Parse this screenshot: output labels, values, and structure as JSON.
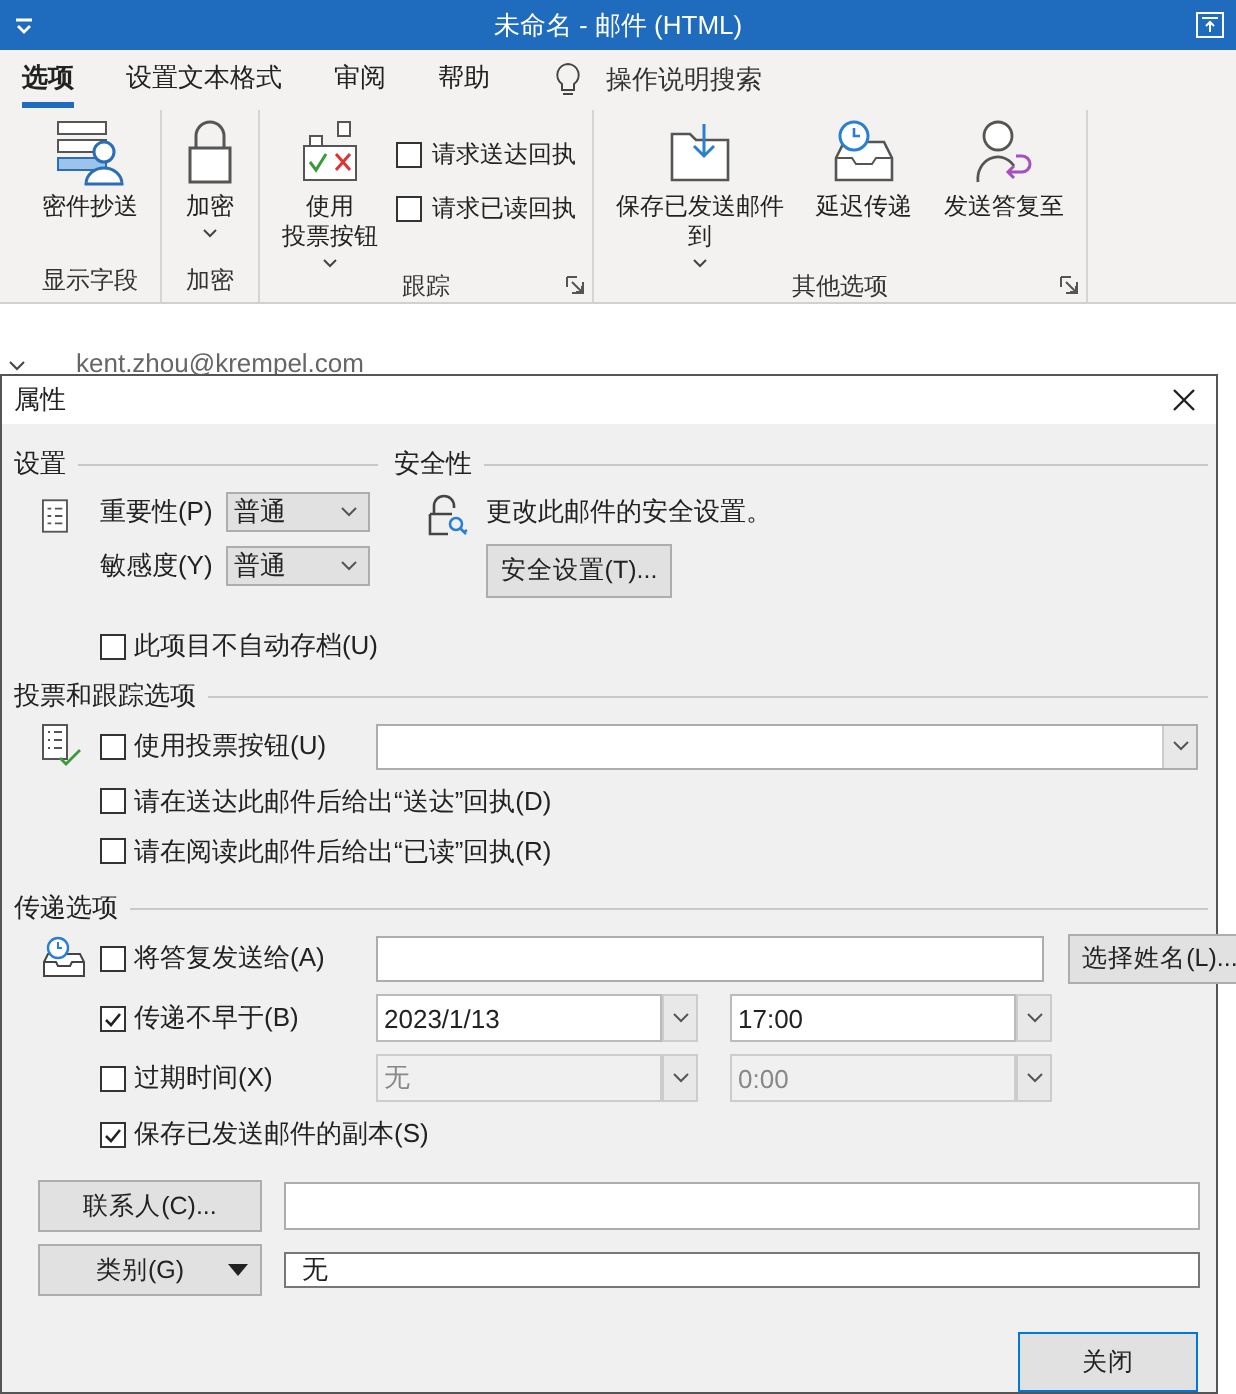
{
  "window": {
    "title": "未命名 - 邮件 (HTML)"
  },
  "ribbon": {
    "tabs": [
      {
        "label": "选项",
        "selected": true
      },
      {
        "label": "设置文本格式",
        "selected": false
      },
      {
        "label": "审阅",
        "selected": false
      },
      {
        "label": "帮助",
        "selected": false
      }
    ],
    "tell_me": "操作说明搜索",
    "groups": [
      {
        "label": "显示字段",
        "launcher": false,
        "items": [
          {
            "kind": "button",
            "label": "密件抄送",
            "caret": false
          }
        ]
      },
      {
        "label": "加密",
        "launcher": false,
        "items": [
          {
            "kind": "button",
            "label": "加密",
            "caret": true
          }
        ]
      },
      {
        "label": "跟踪",
        "launcher": true,
        "items": [
          {
            "kind": "button",
            "label": "使用",
            "label2": "投票按钮",
            "caret": true
          },
          {
            "kind": "checks",
            "checks": [
              {
                "label": "请求送达回执",
                "checked": false
              },
              {
                "label": "请求已读回执",
                "checked": false
              }
            ]
          }
        ]
      },
      {
        "label": "其他选项",
        "launcher": true,
        "items": [
          {
            "kind": "button",
            "label": "保存已发送邮件",
            "label2": "到",
            "caret": true
          },
          {
            "kind": "button",
            "label": "延迟传递",
            "caret": false
          },
          {
            "kind": "button",
            "label": "发送答复至",
            "caret": false
          }
        ]
      }
    ]
  },
  "compose": {
    "from": "kent.zhou@krempel.com"
  },
  "dialog": {
    "title": "属性",
    "settings": {
      "heading": "设置",
      "importance": {
        "label": "重要性(P)",
        "value": "普通"
      },
      "sensitivity": {
        "label": "敏感度(Y)",
        "value": "普通"
      },
      "no_archive": {
        "label": "此项目不自动存档(U)",
        "checked": false
      }
    },
    "security": {
      "heading": "安全性",
      "text": "更改此邮件的安全设置。",
      "button": "安全设置(T)..."
    },
    "voting": {
      "heading": "投票和跟踪选项",
      "options": [
        {
          "kind": "combo",
          "label": "使用投票按钮(U)",
          "checked": false
        },
        {
          "kind": "check",
          "label": "请在送达此邮件后给出“送达”回执(D)",
          "checked": false
        },
        {
          "kind": "check",
          "label": "请在阅读此邮件后给出“已读”回执(R)",
          "checked": false
        }
      ]
    },
    "delivery": {
      "heading": "传递选项",
      "options": [
        {
          "kind": "field",
          "label": "将答复发送给(A)",
          "checked": false,
          "button": "选择姓名(L)..."
        },
        {
          "kind": "datetime",
          "label": "传递不早于(B)",
          "checked": true,
          "date": "2023/1/13",
          "time": "17:00",
          "disabled": false
        },
        {
          "kind": "datetime",
          "label": "过期时间(X)",
          "checked": false,
          "date": "无",
          "time": "0:00",
          "disabled": true
        },
        {
          "kind": "check",
          "label": "保存已发送邮件的副本(S)",
          "checked": true
        }
      ]
    },
    "contacts_button": "联系人(C)...",
    "categories_button": "类别(G)",
    "categories_value": "无",
    "close_button": "关闭"
  }
}
